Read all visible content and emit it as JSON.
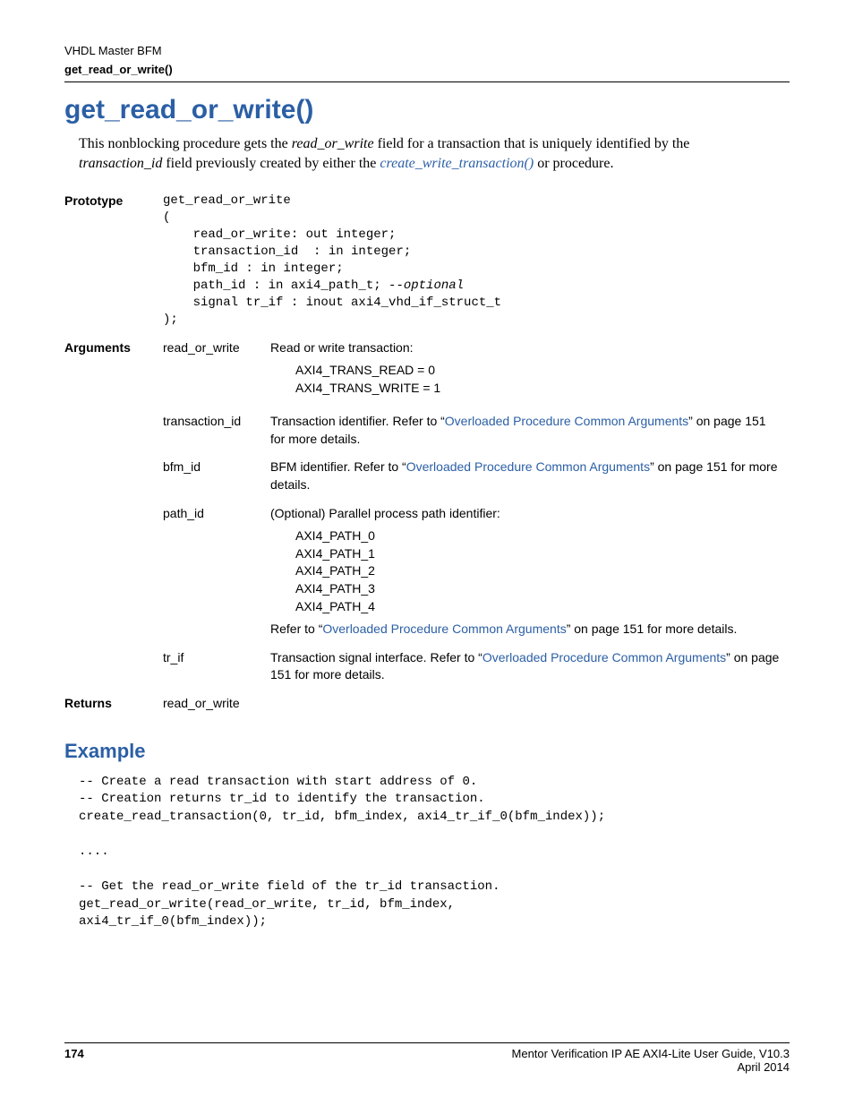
{
  "header": {
    "line1": "VHDL Master BFM",
    "line2": "get_read_or_write()"
  },
  "title": "get_read_or_write()",
  "intro": {
    "pre": "This nonblocking procedure gets the ",
    "field": "read_or_write",
    "mid": " field for a transaction that is uniquely identified by the ",
    "tid": "transaction_id",
    "post": " field previously created by either the ",
    "link": "create_write_transaction()",
    "tail": " or  procedure."
  },
  "labels": {
    "prototype": "Prototype",
    "arguments": "Arguments",
    "returns": "Returns"
  },
  "prototype": {
    "l1": "get_read_or_write",
    "l2": "(",
    "l3": "    read_or_write: out integer;",
    "l4": "    transaction_id  : in integer;",
    "l5": "    bfm_id : in integer;",
    "l6a": "    path_id : in axi4_path_t; ",
    "l6b": "--optional",
    "l7": "    signal tr_if : inout axi4_vhd_if_struct_t",
    "l8": ");"
  },
  "args": {
    "row": {
      "name": "read_or_write",
      "desc": "Read or write transaction:",
      "v1": "AXI4_TRANS_READ = 0",
      "v2": "AXI4_TRANS_WRITE = 1"
    },
    "tid": {
      "name": "transaction_id",
      "pre": "Transaction identifier. Refer to “",
      "link": "Overloaded Procedure Common Arguments",
      "post": "” on page 151 for more details."
    },
    "bfm": {
      "name": "bfm_id",
      "pre": "BFM identifier. Refer to “",
      "link": "Overloaded Procedure Common Arguments",
      "post": "” on page 151 for more details."
    },
    "path": {
      "name": "path_id",
      "desc": "(Optional) Parallel process path identifier:",
      "v1": "AXI4_PATH_0",
      "v2": "AXI4_PATH_1",
      "v3": "AXI4_PATH_2",
      "v4": "AXI4_PATH_3",
      "v5": "AXI4_PATH_4",
      "ref_pre": "Refer to “",
      "ref_link": "Overloaded Procedure Common Arguments",
      "ref_post": "” on page 151 for more details."
    },
    "trif": {
      "name": "tr_if",
      "pre": "Transaction signal interface. Refer to “",
      "link": "Overloaded Procedure Common Arguments",
      "post": "” on page 151 for more details."
    }
  },
  "returns": "read_or_write",
  "example": {
    "heading": "Example",
    "code": "-- Create a read transaction with start address of 0.\n-- Creation returns tr_id to identify the transaction.\ncreate_read_transaction(0, tr_id, bfm_index, axi4_tr_if_0(bfm_index));\n\n....\n\n-- Get the read_or_write field of the tr_id transaction.\nget_read_or_write(read_or_write, tr_id, bfm_index,\naxi4_tr_if_0(bfm_index));"
  },
  "footer": {
    "page": "174",
    "guide": "Mentor Verification IP AE AXI4-Lite User Guide, V10.3",
    "date": "April 2014"
  }
}
